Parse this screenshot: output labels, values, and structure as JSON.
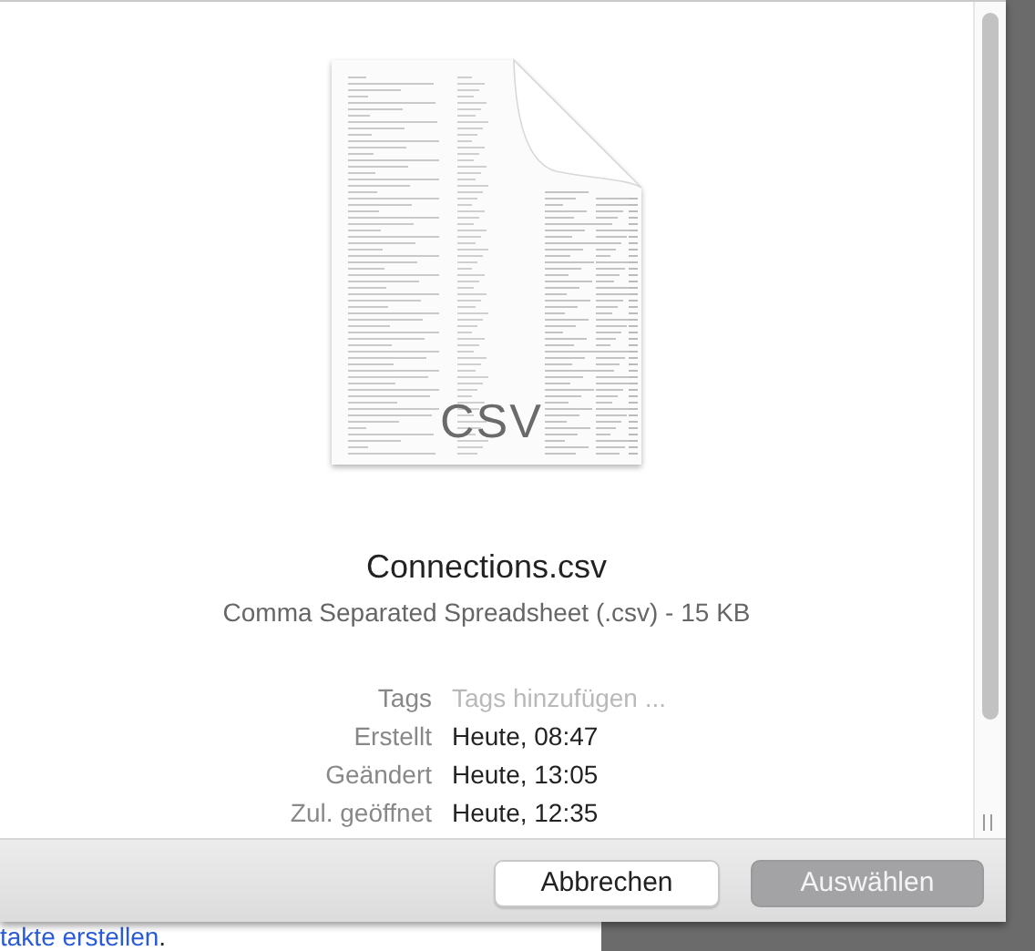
{
  "background_page": {
    "link": "takte erstellen",
    "trailing_text": "."
  },
  "preview": {
    "icon_label": "CSV",
    "file_name": "Connections.csv",
    "file_info": "Comma Separated Spreadsheet (.csv) - 15 KB",
    "details": [
      {
        "label": "Tags",
        "kind": "field",
        "placeholder": "Tags hinzufügen ..."
      },
      {
        "label": "Erstellt",
        "kind": "text",
        "value": "Heute, 08:47"
      },
      {
        "label": "Geändert",
        "kind": "text",
        "value": "Heute, 13:05"
      },
      {
        "label": "Zul. geöffnet",
        "kind": "text",
        "value": "Heute, 12:35"
      }
    ]
  },
  "buttons": [
    {
      "label": "Abbrechen",
      "kind": "secondary"
    },
    {
      "label": "Auswählen",
      "kind": "default"
    }
  ]
}
